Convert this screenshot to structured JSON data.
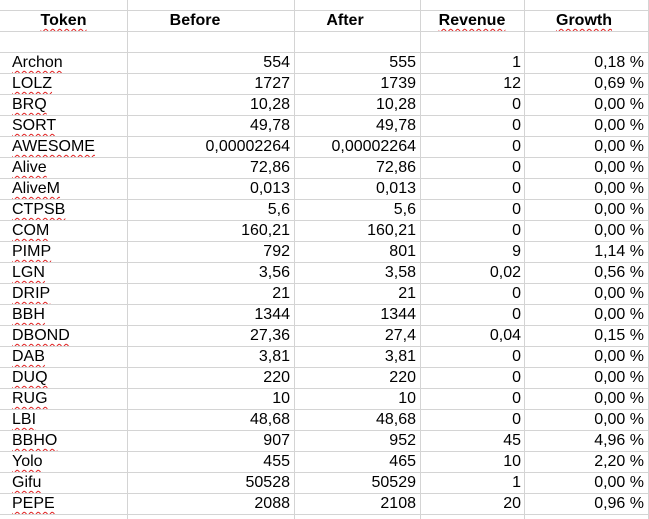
{
  "headers": {
    "token": "Token",
    "before": "Before",
    "after": "After",
    "revenue": "Revenue",
    "growth": "Growth"
  },
  "rows": [
    {
      "token": "Archon",
      "before": "554",
      "after": "555",
      "revenue": "1",
      "growth": "0,18 %"
    },
    {
      "token": "LOLZ",
      "before": "1727",
      "after": "1739",
      "revenue": "12",
      "growth": "0,69 %"
    },
    {
      "token": "BRQ",
      "before": "10,28",
      "after": "10,28",
      "revenue": "0",
      "growth": "0,00 %"
    },
    {
      "token": "SORT",
      "before": "49,78",
      "after": "49,78",
      "revenue": "0",
      "growth": "0,00 %"
    },
    {
      "token": "AWESOME",
      "before": "0,00002264",
      "after": "0,00002264",
      "revenue": "0",
      "growth": "0,00 %"
    },
    {
      "token": "Alive",
      "before": "72,86",
      "after": "72,86",
      "revenue": "0",
      "growth": "0,00 %"
    },
    {
      "token": "AliveM",
      "before": "0,013",
      "after": "0,013",
      "revenue": "0",
      "growth": "0,00 %"
    },
    {
      "token": "CTPSB",
      "before": "5,6",
      "after": "5,6",
      "revenue": "0",
      "growth": "0,00 %"
    },
    {
      "token": "COM",
      "before": "160,21",
      "after": "160,21",
      "revenue": "0",
      "growth": "0,00 %"
    },
    {
      "token": "PIMP",
      "before": "792",
      "after": "801",
      "revenue": "9",
      "growth": "1,14 %"
    },
    {
      "token": "LGN",
      "before": "3,56",
      "after": "3,58",
      "revenue": "0,02",
      "growth": "0,56 %"
    },
    {
      "token": "DRIP",
      "before": "21",
      "after": "21",
      "revenue": "0",
      "growth": "0,00 %"
    },
    {
      "token": "BBH",
      "before": "1344",
      "after": "1344",
      "revenue": "0",
      "growth": "0,00 %"
    },
    {
      "token": "DBOND",
      "before": "27,36",
      "after": "27,4",
      "revenue": "0,04",
      "growth": "0,15 %"
    },
    {
      "token": "DAB",
      "before": "3,81",
      "after": "3,81",
      "revenue": "0",
      "growth": "0,00 %"
    },
    {
      "token": "DUQ",
      "before": "220",
      "after": "220",
      "revenue": "0",
      "growth": "0,00 %"
    },
    {
      "token": "RUG",
      "before": "10",
      "after": "10",
      "revenue": "0",
      "growth": "0,00 %"
    },
    {
      "token": "LBI",
      "before": "48,68",
      "after": "48,68",
      "revenue": "0",
      "growth": "0,00 %"
    },
    {
      "token": "BBHO",
      "before": "907",
      "after": "952",
      "revenue": "45",
      "growth": "4,96 %"
    },
    {
      "token": "Yolo",
      "before": "455",
      "after": "465",
      "revenue": "10",
      "growth": "2,20 %"
    },
    {
      "token": "Gifu",
      "before": "50528",
      "after": "50529",
      "revenue": "1",
      "growth": "0,00 %"
    },
    {
      "token": "PEPE",
      "before": "2088",
      "after": "2108",
      "revenue": "20",
      "growth": "0,96 %"
    }
  ],
  "colors": {
    "gridline": "#d4d4d4",
    "spellcheck": "#e02020",
    "text": "#000000",
    "background": "#ffffff"
  }
}
